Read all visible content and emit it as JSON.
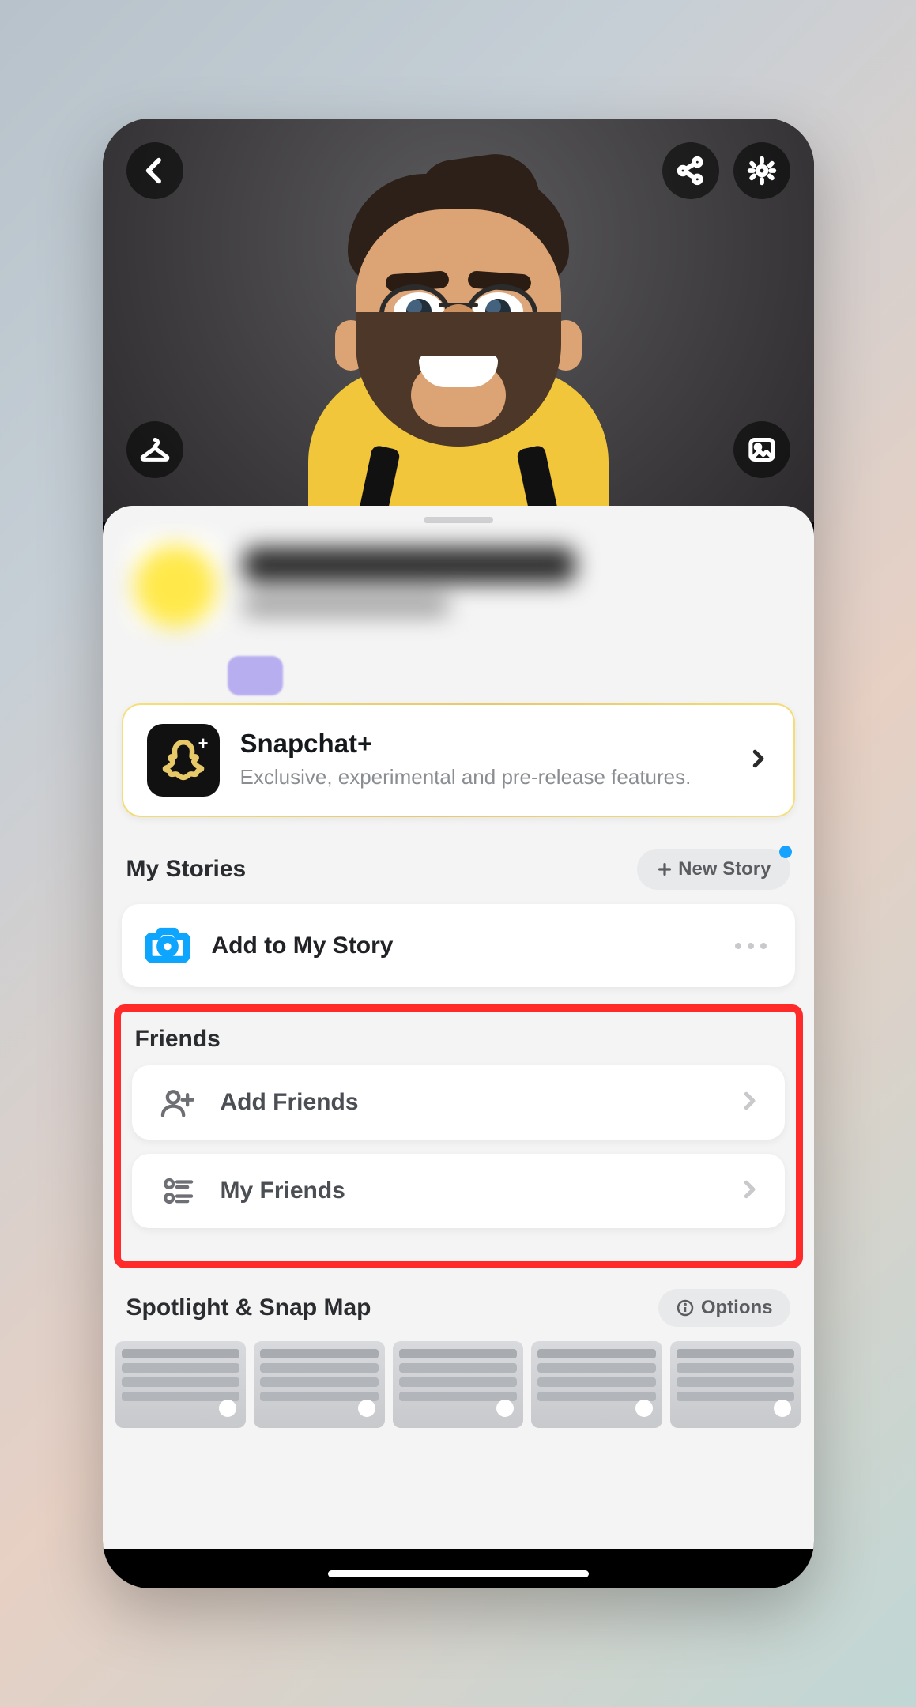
{
  "promo": {
    "title": "Snapchat+",
    "subtitle": "Exclusive, experimental and pre-release features."
  },
  "stories": {
    "heading": "My Stories",
    "new_button": "New Story",
    "add_label": "Add to My Story"
  },
  "friends": {
    "heading": "Friends",
    "add_label": "Add Friends",
    "my_label": "My Friends"
  },
  "spotlight": {
    "heading": "Spotlight & Snap Map",
    "options_label": "Options"
  }
}
